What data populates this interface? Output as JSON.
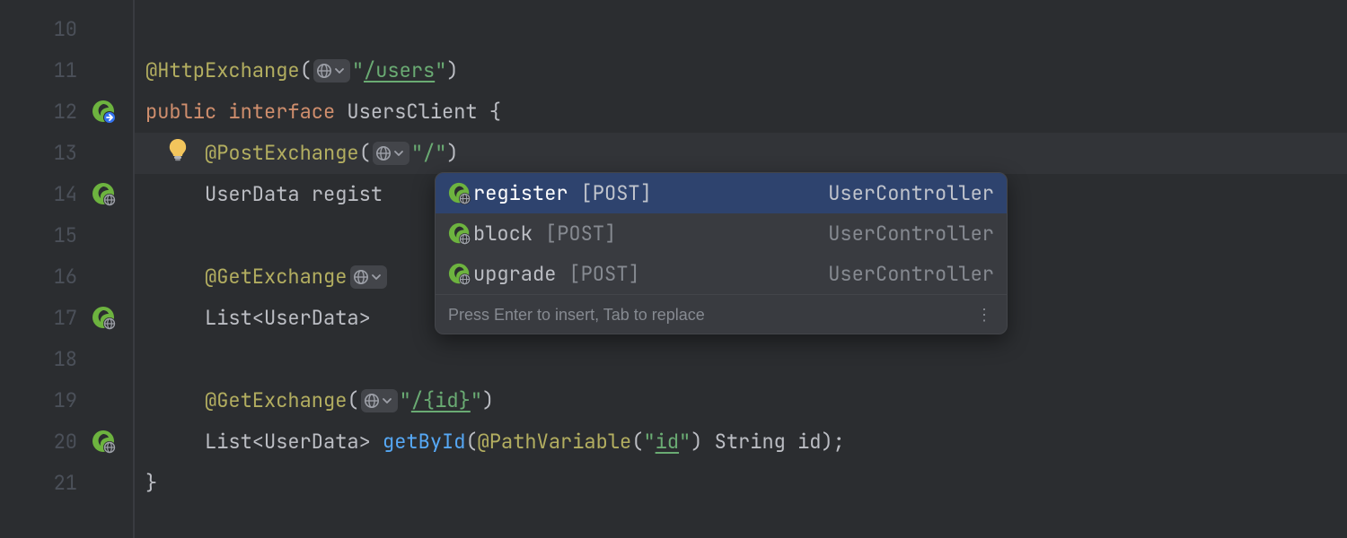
{
  "gutter": {
    "lines": [
      "10",
      "11",
      "12",
      "13",
      "14",
      "15",
      "16",
      "17",
      "18",
      "19",
      "20",
      "21"
    ]
  },
  "code": {
    "l11": {
      "ann": "@HttpExchange",
      "p1": "(",
      "str_q1": "\"",
      "str_path": "/users",
      "str_q2": "\"",
      "p2": ")"
    },
    "l12": {
      "kw1": "public ",
      "kw2": "interface ",
      "name": "UsersClient ",
      "brace": "{"
    },
    "l13": {
      "ann": "@PostExchange",
      "p1": "(",
      "str": "\"/\"",
      "p2": ")"
    },
    "l14": {
      "type": "UserData ",
      "frag": "regist"
    },
    "l16": {
      "ann": "@GetExchange"
    },
    "l17": {
      "type": "List<UserData> "
    },
    "l19": {
      "ann": "@GetExchange",
      "p1": "(",
      "str_q1": "\"",
      "str_path": "/{id}",
      "str_q2": "\"",
      "p2": ")"
    },
    "l20": {
      "type": "List<UserData> ",
      "meth": "getById",
      "p1": "(",
      "ann2": "@PathVariable",
      "p2": "(",
      "str_q1": "\"",
      "str_id": "id",
      "str_q2": "\"",
      "p3": ") ",
      "argtype": "String ",
      "argname": "id",
      "p4": ");"
    },
    "l21": {
      "brace": "}"
    }
  },
  "popup": {
    "items": [
      {
        "name": "register",
        "method": "[POST]",
        "loc": "UserController"
      },
      {
        "name": "block",
        "method": "[POST]",
        "loc": "UserController"
      },
      {
        "name": "upgrade",
        "method": "[POST]",
        "loc": "UserController"
      }
    ],
    "hint": "Press Enter to insert, Tab to replace"
  }
}
